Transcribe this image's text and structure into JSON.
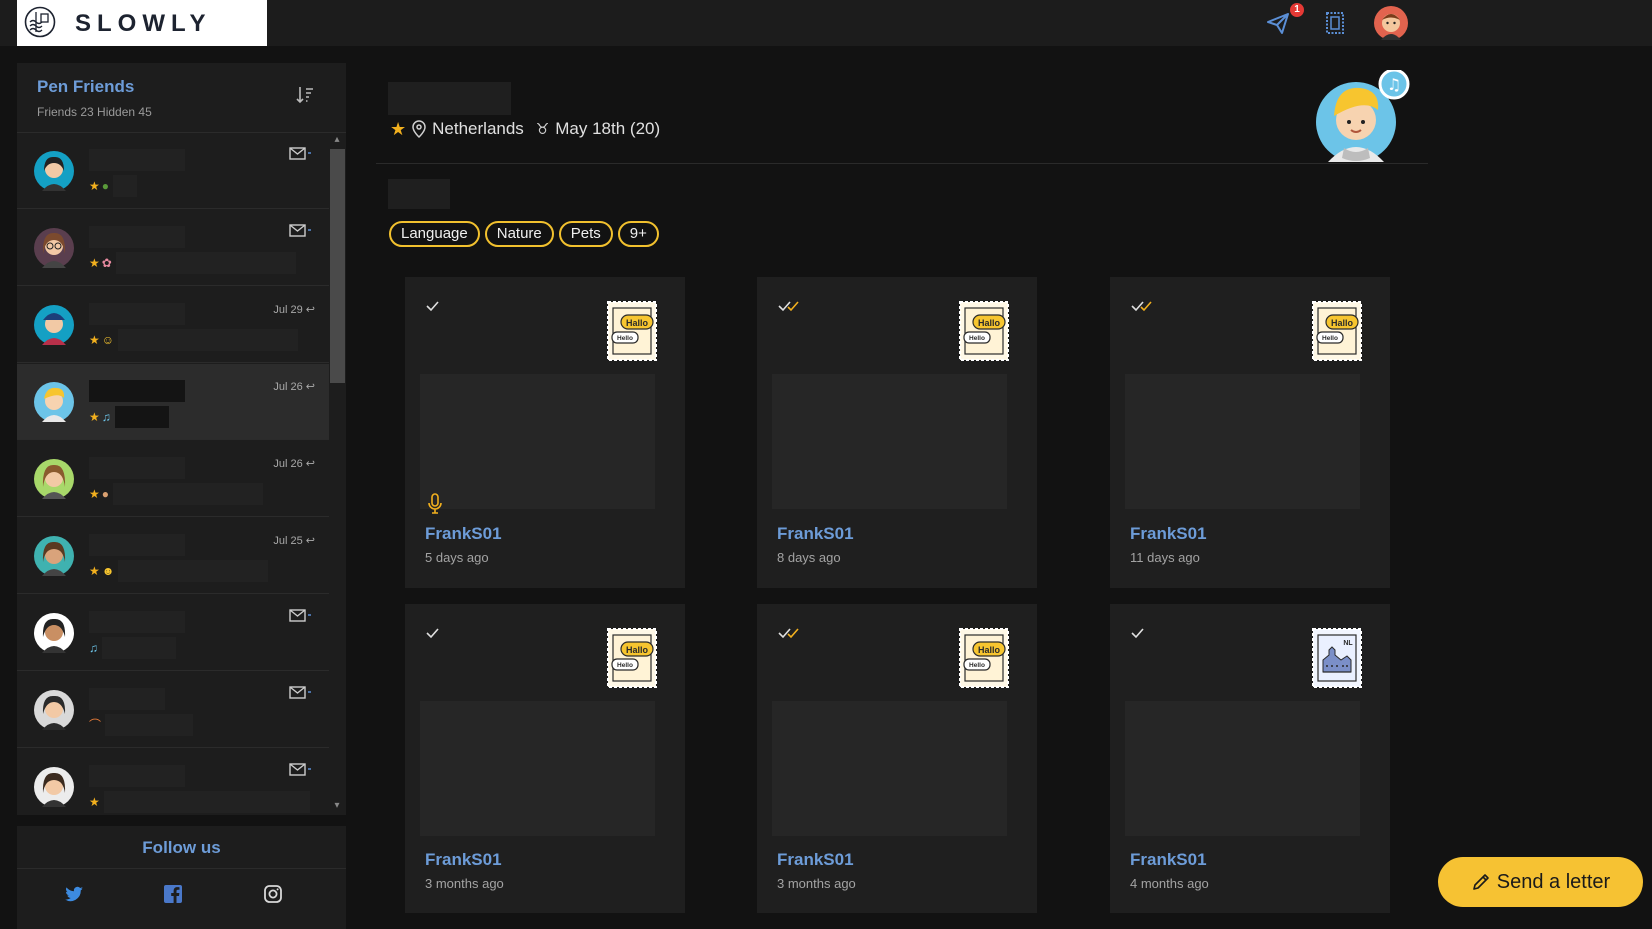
{
  "app": {
    "brand": "SLOWLY"
  },
  "topbar": {
    "icons": [
      "send-plane-icon",
      "stamp-collection-icon",
      "user-avatar"
    ],
    "notification_count": "1"
  },
  "sidebar": {
    "title": "Pen Friends",
    "subtitle": "Friends 23  Hidden 45",
    "friends": [
      {
        "date": "",
        "icons": [
          "star",
          "turtle"
        ],
        "action": "mail"
      },
      {
        "date": "",
        "icons": [
          "star",
          "flower"
        ],
        "action": "mail"
      },
      {
        "date": "Jul 29",
        "icons": [
          "star",
          "smile"
        ],
        "action": "reply"
      },
      {
        "date": "Jul 26",
        "icons": [
          "star",
          "music"
        ],
        "action": "reply",
        "selected": true
      },
      {
        "date": "Jul 26",
        "icons": [
          "star",
          "palette"
        ],
        "action": "reply"
      },
      {
        "date": "Jul 25",
        "icons": [
          "star",
          "grin"
        ],
        "action": "reply"
      },
      {
        "date": "",
        "icons": [
          "music"
        ],
        "action": "mail"
      },
      {
        "date": "",
        "icons": [
          "rainbow"
        ],
        "action": "mail"
      },
      {
        "date": "",
        "icons": [
          "star"
        ],
        "action": "mail"
      }
    ]
  },
  "follow": {
    "title": "Follow us",
    "networks": [
      "twitter-icon",
      "facebook-icon",
      "instagram-icon"
    ]
  },
  "profile": {
    "location": "Netherlands",
    "birthday": "May 18th (20)",
    "tags": [
      "Language",
      "Nature",
      "Pets",
      "9+"
    ]
  },
  "letters": [
    {
      "author": "FrankS01",
      "time": "5 days ago",
      "read": "single",
      "stamp": "hallo-hello",
      "audio": true
    },
    {
      "author": "FrankS01",
      "time": "8 days ago",
      "read": "double",
      "stamp": "hallo-hello",
      "audio": false
    },
    {
      "author": "FrankS01",
      "time": "11 days ago",
      "read": "double",
      "stamp": "hallo-hello",
      "audio": false
    },
    {
      "author": "FrankS01",
      "time": "3 months ago",
      "read": "single",
      "stamp": "hallo-hello",
      "audio": false
    },
    {
      "author": "FrankS01",
      "time": "3 months ago",
      "read": "double",
      "stamp": "hallo-hello",
      "audio": false
    },
    {
      "author": "FrankS01",
      "time": "4 months ago",
      "read": "single",
      "stamp": "nl-building",
      "audio": false
    }
  ],
  "stamp_text": {
    "big": "Hallo",
    "small": "Hello",
    "nl": "NL"
  },
  "send_button": {
    "label": "Send a letter"
  },
  "colors": {
    "accent_blue": "#6d9cd8",
    "accent_yellow": "#f2c12e",
    "check_yellow": "#f2b01e"
  }
}
